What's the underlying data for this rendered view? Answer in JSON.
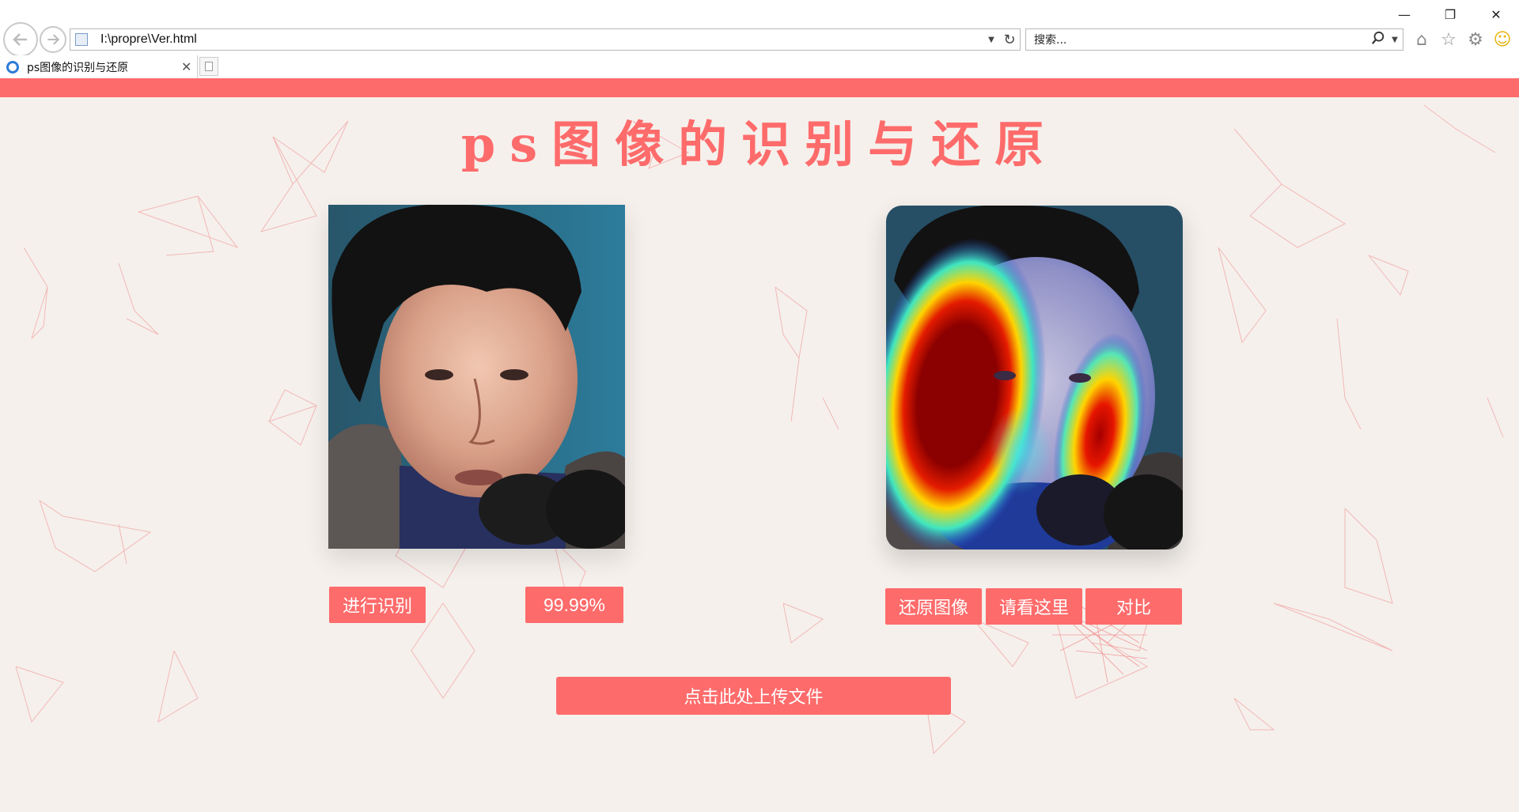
{
  "browser": {
    "url": "I:\\propre\\Ver.html",
    "search_placeholder": "搜索...",
    "tab_title": "ps图像的识别与还原",
    "window_controls": [
      "minimize",
      "restore",
      "close"
    ],
    "icons": [
      "back-icon",
      "forward-icon",
      "refresh-icon",
      "search-icon",
      "home-icon",
      "favorites-star-icon",
      "settings-gear-icon",
      "feedback-smiley-icon"
    ]
  },
  "page": {
    "title": "ps图像的识别与还原",
    "accent_color": "#fe6b6b",
    "background_color": "#f5f0ec",
    "left_panel": {
      "recognize_button": "进行识别",
      "score": "99.99%"
    },
    "right_panel": {
      "restore_button": "还原图像",
      "look_button": "请看这里",
      "compare_button": "对比"
    },
    "upload_button": "点击此处上传文件"
  }
}
